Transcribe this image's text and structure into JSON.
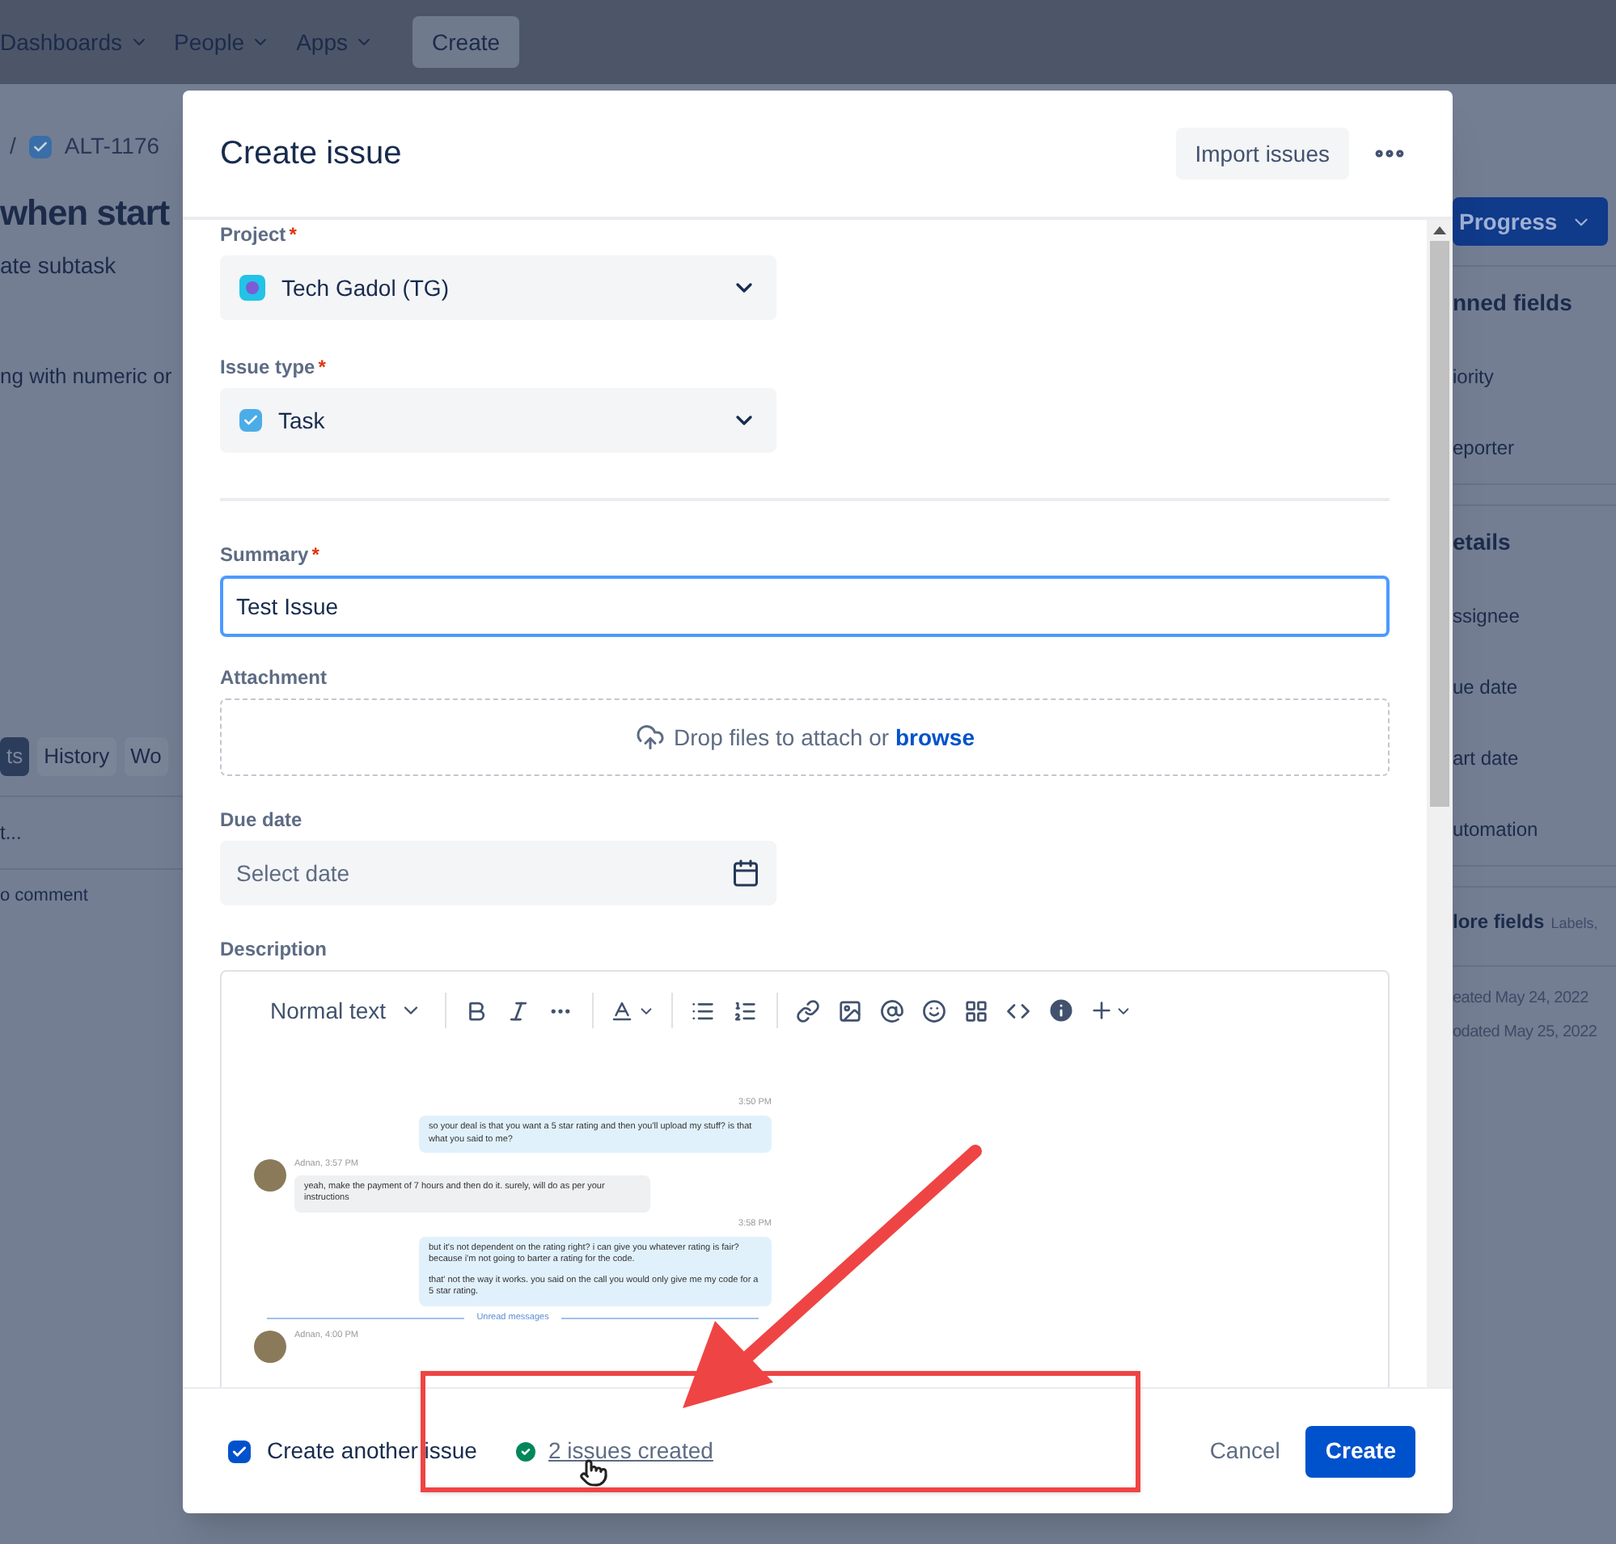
{
  "top_nav": {
    "items": [
      {
        "label": "Dashboards",
        "kind": "menu"
      },
      {
        "label": "People",
        "kind": "menu"
      },
      {
        "label": "Apps",
        "kind": "menu"
      },
      {
        "label": "Create",
        "kind": "button"
      }
    ]
  },
  "background_issue": {
    "breadcrumb_separator": "/",
    "issue_key": "ALT-1176",
    "title": "when start",
    "actions": [
      "ate subtask"
    ],
    "description": "ng with numeric or",
    "tabs": [
      {
        "label": "ts",
        "selected": true
      },
      {
        "label": "History",
        "selected": false
      },
      {
        "label": "Wo",
        "selected": false
      }
    ],
    "comment_placeholder": "t...",
    "comment_hint": "o comment",
    "status_button": "Progress",
    "sections": [
      {
        "title": "nned fields",
        "fields": [
          "iority",
          "eporter"
        ]
      },
      {
        "title": "etails",
        "fields": [
          "ssignee",
          "ue date",
          "art date",
          "utomation"
        ]
      },
      {
        "title": "lore fields",
        "hint": "Labels,"
      }
    ],
    "dates": [
      "eated May 24, 2022",
      "odated May 25, 2022"
    ]
  },
  "dialog": {
    "title": "Create issue",
    "header_button": "Import issues",
    "fields": [
      {
        "kind": "select",
        "label": "Project",
        "required_mark": "*",
        "value": "Tech Gadol (TG)"
      },
      {
        "kind": "select",
        "label": "Issue type",
        "required_mark": "*",
        "value": "Task"
      },
      {
        "kind": "divider"
      },
      {
        "kind": "input",
        "label": "Summary",
        "required_mark": "*",
        "value": "Test Issue",
        "focused": true
      },
      {
        "kind": "dropzone",
        "label": "Attachment",
        "text": "Drop files to attach or ",
        "link": "browse"
      },
      {
        "kind": "date",
        "label": "Due date",
        "placeholder": "Select date"
      },
      {
        "kind": "editor",
        "label": "Description",
        "format": "Normal text"
      }
    ],
    "chat": [
      {
        "kind": "time",
        "text": "3:50 PM"
      },
      {
        "kind": "sent",
        "texts": [
          "so your deal is that you want a 5 star rating and then you'll upload my stuff?  is that what you said to me?"
        ]
      },
      {
        "kind": "received",
        "author": "Adnan, 3:57 PM",
        "texts": [
          "yeah, make the payment of 7 hours and then do it. surely, will do as per your instructions"
        ]
      },
      {
        "kind": "time",
        "text": "3:58 PM"
      },
      {
        "kind": "sent",
        "texts": [
          "but it's not dependent on the rating right?  i can give you whatever rating is fair?  because i'm not going to barter a rating for the code.",
          "that' not the way it works.  you said on the call you would only give me my code for a 5 star rating."
        ]
      },
      {
        "kind": "divider",
        "text": "Unread messages"
      },
      {
        "kind": "received",
        "author": "Adnan, 4:00 PM"
      }
    ],
    "footer": {
      "create_another": {
        "label": "Create another issue",
        "checked": true
      },
      "success": "2 issues created",
      "cancel": "Cancel",
      "submit": "Create"
    }
  }
}
